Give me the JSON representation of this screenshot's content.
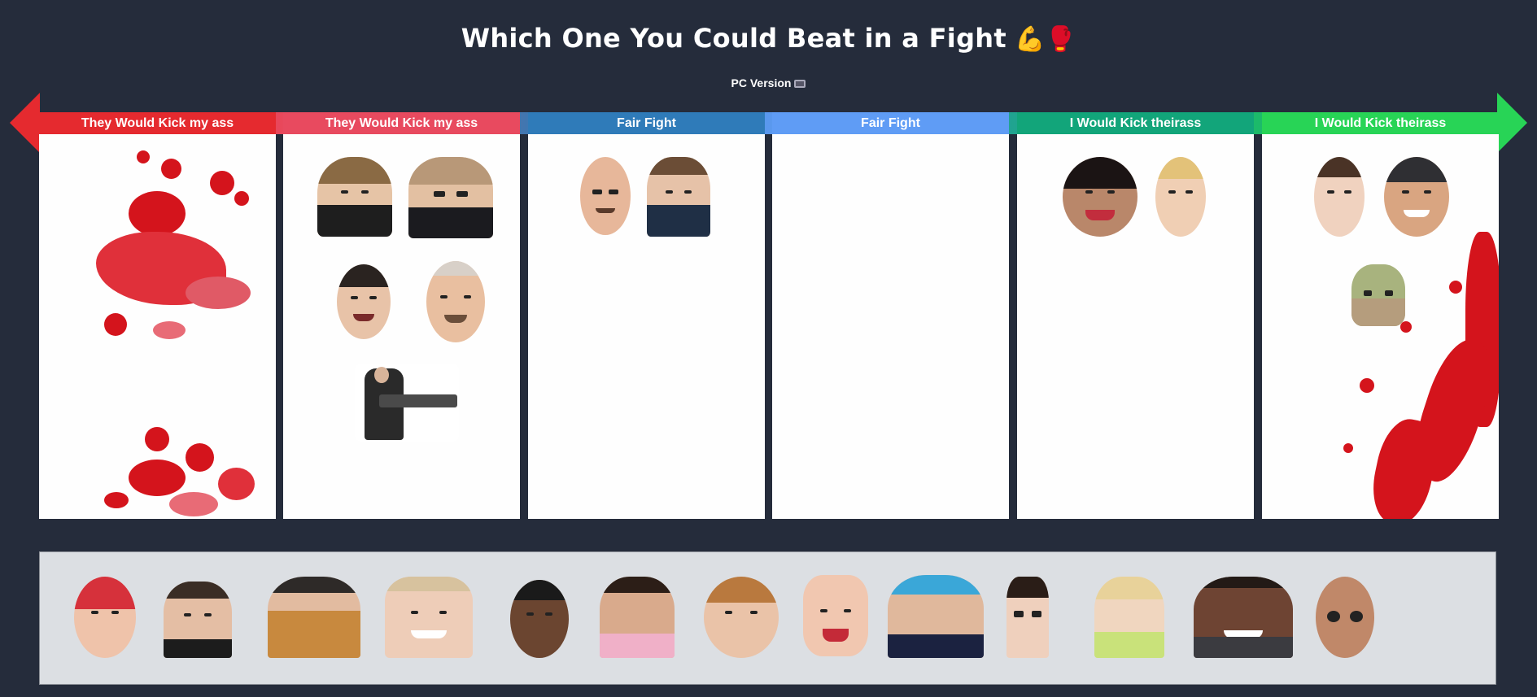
{
  "header": {
    "title": "Which One You Could Beat in a Fight",
    "title_emoji": "💪🥊",
    "subtitle": "PC Version"
  },
  "tiers": [
    {
      "label": "They Would Kick my ass",
      "color": "#e52a2f",
      "items": [
        "character-1"
      ]
    },
    {
      "label": "They Would Kick my ass",
      "color": "#e84a5f",
      "items": [
        "character-1",
        "character-2",
        "character-3",
        "character-4",
        "character-5"
      ]
    },
    {
      "label": "Fair Fight",
      "color": "#2f7bb9",
      "items": [
        "character-1",
        "character-2"
      ]
    },
    {
      "label": "Fair Fight",
      "color": "#5f9cf5",
      "items": []
    },
    {
      "label": "I Would Kick theirass",
      "color": "#12a57a",
      "items": [
        "character-1",
        "character-2"
      ]
    },
    {
      "label": "I Would Kick theirass",
      "color": "#28d456",
      "items": [
        "character-1",
        "character-2",
        "character-3"
      ]
    }
  ],
  "pool": {
    "items": [
      "character-1",
      "character-2",
      "character-3",
      "character-4",
      "character-5",
      "character-6",
      "character-7",
      "character-8",
      "character-9",
      "character-10",
      "character-11",
      "character-12",
      "character-13"
    ]
  },
  "icons": {
    "left_arrow": "arrow-left-icon",
    "right_arrow": "arrow-right-icon",
    "monitor": "monitor-icon"
  }
}
